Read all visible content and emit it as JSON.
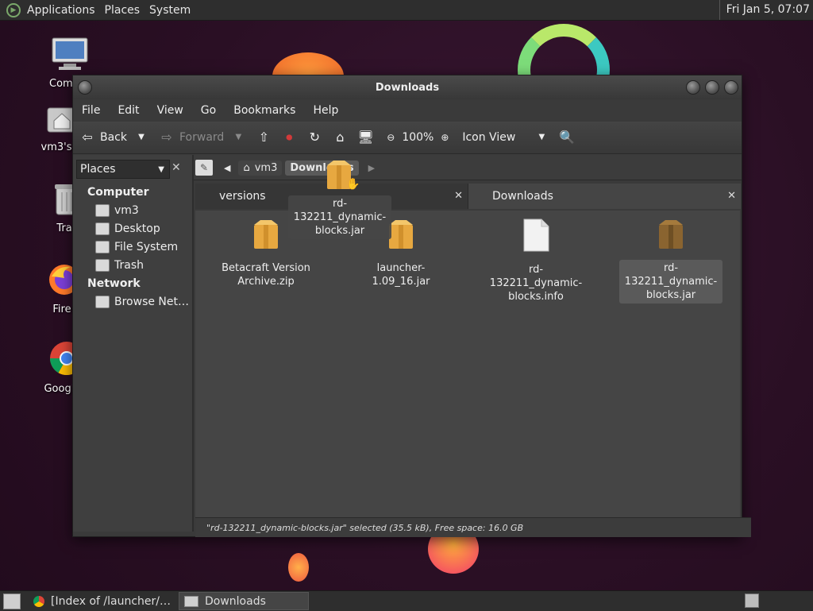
{
  "top_panel": {
    "menus": [
      "Applications",
      "Places",
      "System"
    ],
    "clock": "Fri Jan  5, 07:07"
  },
  "desktop_icons": [
    {
      "label": "Comp",
      "icon": "computer-icon"
    },
    {
      "label": "vm3's I",
      "icon": "home-folder-icon"
    },
    {
      "label": "Tra",
      "icon": "trash-icon"
    },
    {
      "label": "Fire",
      "icon": "firefox-icon"
    },
    {
      "label": "Google C",
      "icon": "chrome-icon"
    }
  ],
  "window": {
    "title": "Downloads",
    "menubar": [
      "File",
      "Edit",
      "View",
      "Go",
      "Bookmarks",
      "Help"
    ],
    "toolbar": {
      "back": "Back",
      "forward": "Forward",
      "zoom": "100%",
      "view_mode": "Icon View"
    },
    "location": {
      "crumbs": [
        "vm3",
        "Downloads"
      ]
    },
    "sidebar": {
      "combo": "Places",
      "sections": [
        {
          "heading": "Computer",
          "items": [
            "vm3",
            "Desktop",
            "File System",
            "Trash"
          ]
        },
        {
          "heading": "Network",
          "items": [
            "Browse Net…"
          ]
        }
      ]
    },
    "tabs": [
      {
        "label": "versions",
        "active": false
      },
      {
        "label": "Downloads",
        "active": true
      }
    ],
    "files": [
      {
        "name": "Betacraft Version Archive.zip",
        "type": "archive",
        "selected": false
      },
      {
        "name": "launcher-1.09_16.jar",
        "type": "archive",
        "selected": false
      },
      {
        "name": "rd-132211_dynamic-blocks.info",
        "type": "document",
        "selected": false
      },
      {
        "name": "rd-132211_dynamic-blocks.jar",
        "type": "archive",
        "selected": true
      }
    ],
    "drag_ghost": "rd-132211_dynamic-blocks.jar",
    "status": "\"rd-132211_dynamic-blocks.jar\" selected (35.5 kB), Free space: 16.0 GB"
  },
  "taskbar": {
    "items": [
      {
        "label": "[Index of /launcher/…",
        "active": false
      },
      {
        "label": "Downloads",
        "active": true
      }
    ]
  },
  "colors": {
    "accent": "#e8a33b",
    "panel": "#2e2e2e",
    "window_bg": "#3a3a3a"
  }
}
